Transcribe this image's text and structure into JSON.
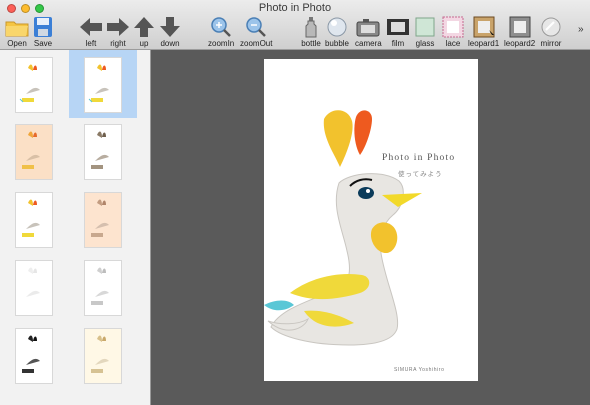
{
  "window": {
    "title": "Photo in Photo"
  },
  "colors": {
    "selection": "#b7d5f5",
    "canvas": "#5a5a5a",
    "sidebar": "#f2f2f2"
  },
  "toolbar": {
    "open": "Open",
    "save": "Save",
    "left": "left",
    "right": "right",
    "up": "up",
    "down": "down",
    "zoomin": "zoomIn",
    "zoomout": "zoomOut",
    "bottle": "bottle",
    "bubble": "bubble",
    "camera": "camera",
    "film": "film",
    "glass": "glass",
    "lace": "lace",
    "leopard1": "leopard1",
    "leopard2": "leopard2",
    "mirror": "mirror",
    "more": "»"
  },
  "poster": {
    "title": "Photo in Photo",
    "subtitle": "使ってみよう",
    "author": "SIMURA Yoshihiro"
  },
  "thumbnails": [
    "color",
    "color-selected",
    "orange-tint",
    "brown-tone",
    "color",
    "peach-tone",
    "faded",
    "grayscale",
    "black",
    "sepia"
  ]
}
